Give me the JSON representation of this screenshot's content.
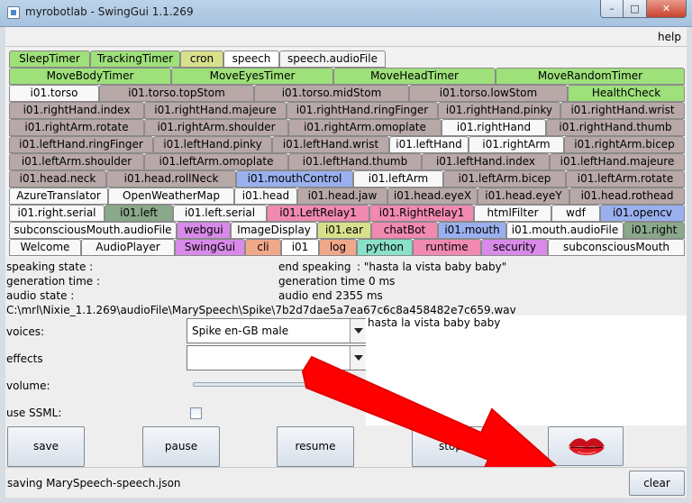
{
  "window": {
    "title": "myrobotlab - SwingGui 1.1.269",
    "minimize": "–",
    "maximize": "□",
    "close": "✕"
  },
  "menu": {
    "help": "help"
  },
  "tab_rows": [
    [
      {
        "label": "SleepTimer",
        "color": "#9ee07a"
      },
      {
        "label": "TrackingTimer",
        "color": "#9ee07a"
      },
      {
        "label": "cron",
        "color": "#d8e08c"
      },
      {
        "label": "speech",
        "color": "#ffffff"
      },
      {
        "label": "speech.audioFile",
        "color": "#f4f4f4"
      }
    ],
    [
      {
        "label": "MoveBodyTimer",
        "color": "#9ee07a"
      },
      {
        "label": "MoveEyesTimer",
        "color": "#9ee07a"
      },
      {
        "label": "MoveHeadTimer",
        "color": "#9ee07a"
      },
      {
        "label": "MoveRandomTimer",
        "color": "#9ee07a"
      }
    ],
    [
      {
        "label": "i01.torso",
        "color": "#f8f8f8"
      },
      {
        "label": "i01.torso.topStom",
        "color": "#b8a8a8"
      },
      {
        "label": "i01.torso.midStom",
        "color": "#b8a8a8"
      },
      {
        "label": "i01.torso.lowStom",
        "color": "#b8a8a8"
      },
      {
        "label": "HealthCheck",
        "color": "#9ee07a"
      }
    ],
    [
      {
        "label": "i01.rightHand.index",
        "color": "#b8a8a8"
      },
      {
        "label": "i01.rightHand.majeure",
        "color": "#b8a8a8"
      },
      {
        "label": "i01.rightHand.ringFinger",
        "color": "#b8a8a8"
      },
      {
        "label": "i01.rightHand.pinky",
        "color": "#b8a8a8"
      },
      {
        "label": "i01.rightHand.wrist",
        "color": "#b8a8a8"
      }
    ],
    [
      {
        "label": "i01.rightArm.rotate",
        "color": "#b8a8a8"
      },
      {
        "label": "i01.rightArm.shoulder",
        "color": "#b8a8a8"
      },
      {
        "label": "i01.rightArm.omoplate",
        "color": "#b8a8a8"
      },
      {
        "label": "i01.rightHand",
        "color": "#f8f8f8"
      },
      {
        "label": "i01.rightHand.thumb",
        "color": "#b8a8a8"
      }
    ],
    [
      {
        "label": "i01.leftHand.ringFinger",
        "color": "#b8a8a8"
      },
      {
        "label": "i01.leftHand.pinky",
        "color": "#b8a8a8"
      },
      {
        "label": "i01.leftHand.wrist",
        "color": "#b8a8a8"
      },
      {
        "label": "i01.leftHand",
        "color": "#f8f8f8"
      },
      {
        "label": "i01.rightArm",
        "color": "#f8f8f8"
      },
      {
        "label": "i01.rightArm.bicep",
        "color": "#b8a8a8"
      }
    ],
    [
      {
        "label": "i01.leftArm.shoulder",
        "color": "#b8a8a8"
      },
      {
        "label": "i01.leftArm.omoplate",
        "color": "#b8a8a8"
      },
      {
        "label": "i01.leftHand.thumb",
        "color": "#b8a8a8"
      },
      {
        "label": "i01.leftHand.index",
        "color": "#b8a8a8"
      },
      {
        "label": "i01.leftHand.majeure",
        "color": "#b8a8a8"
      }
    ],
    [
      {
        "label": "i01.head.neck",
        "color": "#b8a8a8"
      },
      {
        "label": "i01.head.rollNeck",
        "color": "#b8a8a8"
      },
      {
        "label": "i01.mouthControl",
        "color": "#9ab0ee"
      },
      {
        "label": "i01.leftArm",
        "color": "#f8f8f8"
      },
      {
        "label": "i01.leftArm.bicep",
        "color": "#b8a8a8"
      },
      {
        "label": "i01.leftArm.rotate",
        "color": "#b8a8a8"
      }
    ],
    [
      {
        "label": "AzureTranslator",
        "color": "#f8f8f8"
      },
      {
        "label": "OpenWeatherMap",
        "color": "#f8f8f8"
      },
      {
        "label": "i01.head",
        "color": "#f8f8f8"
      },
      {
        "label": "i01.head.jaw",
        "color": "#b8a8a8"
      },
      {
        "label": "i01.head.eyeX",
        "color": "#b8a8a8"
      },
      {
        "label": "i01.head.eyeY",
        "color": "#b8a8a8"
      },
      {
        "label": "i01.head.rothead",
        "color": "#b8a8a8"
      }
    ],
    [
      {
        "label": "i01.right.serial",
        "color": "#f8f8f8"
      },
      {
        "label": "i01.left",
        "color": "#8aa88a"
      },
      {
        "label": "i01.left.serial",
        "color": "#f8f8f8"
      },
      {
        "label": "i01.LeftRelay1",
        "color": "#f08ab0"
      },
      {
        "label": "i01.RightRelay1",
        "color": "#f08ab0"
      },
      {
        "label": "htmlFilter",
        "color": "#f8f8f8"
      },
      {
        "label": "wdf",
        "color": "#f8f8f8"
      },
      {
        "label": "i01.opencv",
        "color": "#9ab0ee"
      }
    ],
    [
      {
        "label": "subconsciousMouth.audioFile",
        "color": "#f8f8f8"
      },
      {
        "label": "webgui",
        "color": "#d88ae8"
      },
      {
        "label": "ImageDisplay",
        "color": "#f8f8f8"
      },
      {
        "label": "i01.ear",
        "color": "#d8e08c"
      },
      {
        "label": "chatBot",
        "color": "#f08ab0"
      },
      {
        "label": "i01.mouth",
        "color": "#9ab0ee"
      },
      {
        "label": "i01.mouth.audioFile",
        "color": "#f8f8f8"
      },
      {
        "label": "i01.right",
        "color": "#8aa88a"
      }
    ],
    [
      {
        "label": "Welcome",
        "color": "#f8f8f8"
      },
      {
        "label": "AudioPlayer",
        "color": "#f8f8f8"
      },
      {
        "label": "SwingGui",
        "color": "#d88ae8"
      },
      {
        "label": "cli",
        "color": "#f0a88a"
      },
      {
        "label": "i01",
        "color": "#ffffff"
      },
      {
        "label": "log",
        "color": "#f0a88a"
      },
      {
        "label": "python",
        "color": "#8ae0c8"
      },
      {
        "label": "runtime",
        "color": "#f08ab0"
      },
      {
        "label": "security",
        "color": "#d88ae8"
      },
      {
        "label": "subconsciousMouth",
        "color": "#f8f8f8"
      }
    ]
  ],
  "info": {
    "speaking_state": "speaking state :",
    "generation_time": "generation time :",
    "audio_state": "audio state :",
    "end_speaking": "end speaking",
    "end_speaking_value": ": \"hasta la vista baby baby\"",
    "generation_time_value": "generation time 0 ms",
    "audio_end": "audio end 2355 ms",
    "audio_path": "C:\\mrl\\Nixie_1.1.269\\audioFile\\MarySpeech\\Spike\\7b2d7dae5a7ea67c6c8a458482e7c659.wav"
  },
  "form": {
    "voices_label": "voices:",
    "voice_value": "Spike en-GB male",
    "effects_label": "effects",
    "effects_value": "",
    "volume_label": "volume:",
    "ssml_label": "use SSML:",
    "text_value": "hasta la vista baby baby"
  },
  "buttons": {
    "save": "save",
    "pause": "pause",
    "resume": "resume",
    "stop": "stop"
  },
  "status": {
    "message": "saving MarySpeech-speech.json",
    "clear": "clear"
  },
  "icons": {
    "app": "app-icon",
    "lips": "lips-icon",
    "arrow": "red-arrow-icon"
  }
}
